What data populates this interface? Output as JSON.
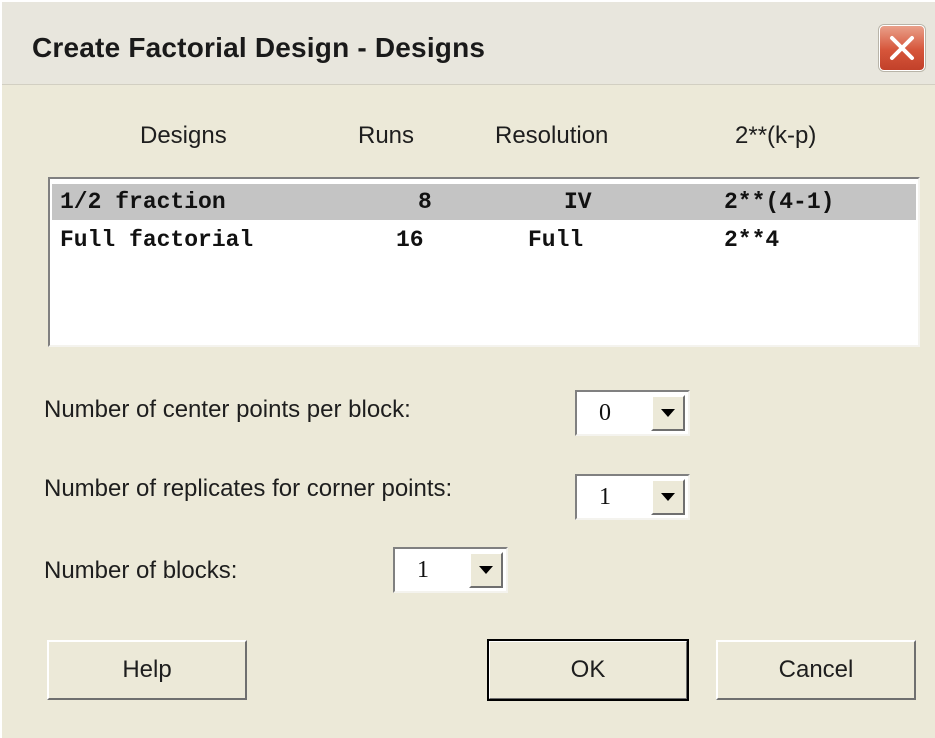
{
  "window": {
    "title": "Create Factorial Design - Designs",
    "close_icon": "close-icon"
  },
  "designs_table": {
    "headers": [
      "Designs",
      "Runs",
      "Resolution",
      "2**(k-p)"
    ],
    "rows": [
      {
        "design": "1/2 fraction",
        "runs": "8",
        "resolution": "IV",
        "notation": "2**(4-1)",
        "selected": true
      },
      {
        "design": "Full factorial",
        "runs": "16",
        "resolution": "Full",
        "notation": "2**4",
        "selected": false
      }
    ]
  },
  "center_points": {
    "label": "Number of center points per block:",
    "value": "0"
  },
  "replicates": {
    "label": "Number of replicates for corner points:",
    "value": "1"
  },
  "blocks": {
    "label": "Number of blocks:",
    "value": "1"
  },
  "buttons": {
    "help": "Help",
    "ok": "OK",
    "cancel": "Cancel"
  },
  "colors": {
    "dialog_bg": "#ece9d8",
    "selected_row": "#c4c4c4",
    "close_button": "#d6553a"
  }
}
